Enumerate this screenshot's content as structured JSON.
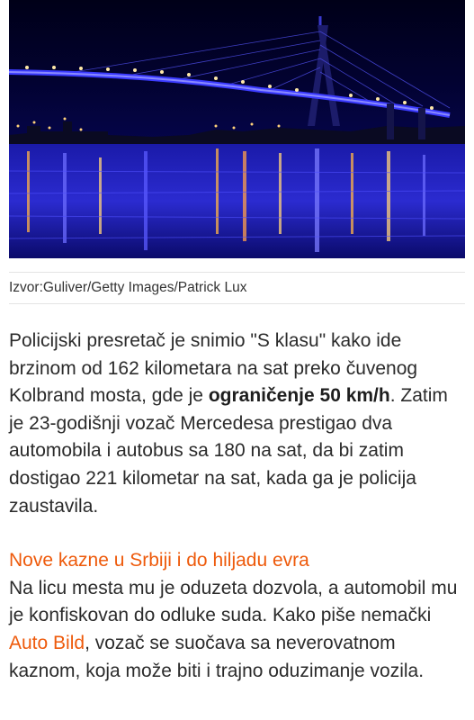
{
  "image": {
    "alt_icon": "bridge-photo",
    "caption": "Izvor:Guliver/Getty Images/Patrick Lux"
  },
  "article": {
    "p1_before": "Policijski presretač je snimio \"S klasu\" kako ide brzinom od 162 kilometara na sat preko čuvenog Kolbrand mosta, gde je ",
    "p1_bold": "ograničenje 50 km/h",
    "p1_after": ". Zatim je 23-godišnji vozač Mercedesa prestigao dva automobila i autobus sa 180 na sat, da bi zatim dostigao 221 kilometar na sat, kada ga je policija zaustavila.",
    "related_link": "Nove kazne u Srbiji i do hiljadu evra",
    "p2_before": "Na licu mesta mu je oduzeta dozvola, a automobil mu je konfiskovan do odluke suda. Kako piše nemački ",
    "p2_link": "Auto Bild",
    "p2_after": ", vozač se suočava sa neverovatnom kaznom, koja može biti i trajno oduzimanje vozila."
  },
  "colors": {
    "link": "#ee5a0b",
    "text": "#2b2b2b",
    "caption": "#333333"
  }
}
